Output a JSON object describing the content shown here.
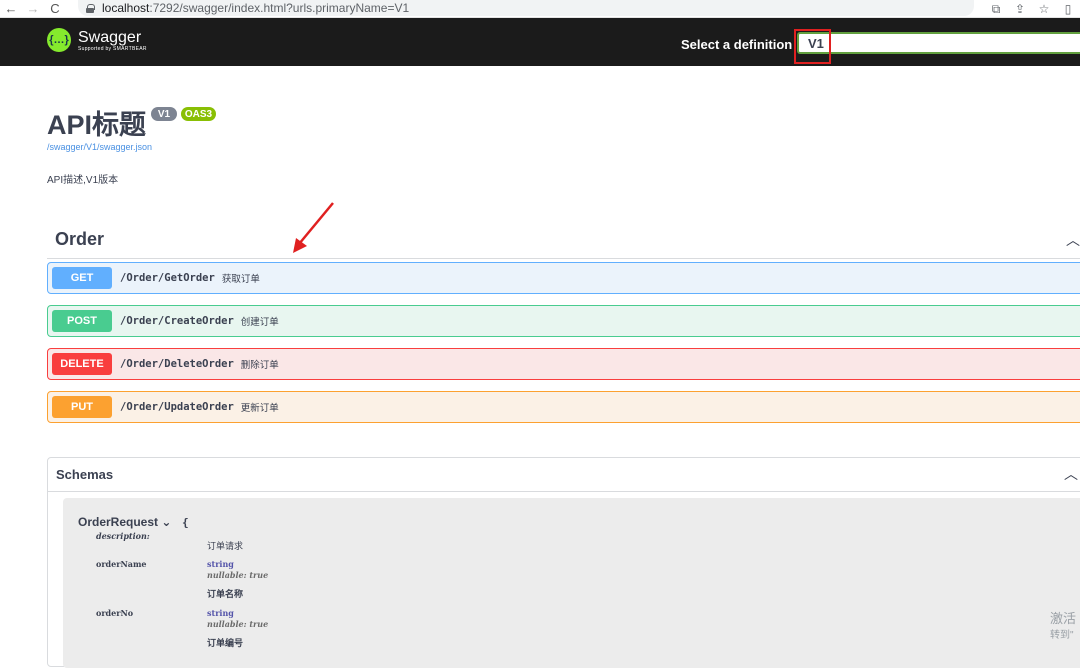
{
  "browser": {
    "url_host": "localhost",
    "url_rest": ":7292/swagger/index.html?urls.primaryName=V1",
    "back": "←",
    "forward": "→",
    "reload": "C"
  },
  "topbar": {
    "logo_mark": "{…}",
    "logo_name": "Swagger",
    "logo_sub": "Supported by SMARTBEAR",
    "select_label": "Select a definition",
    "selected_definition": "V1"
  },
  "info": {
    "title": "API标题",
    "version_badge": "V1",
    "oas_badge": "OAS3",
    "spec_url": "/swagger/V1/swagger.json",
    "description": "API描述,V1版本"
  },
  "tag": {
    "name": "Order",
    "operations": [
      {
        "method": "GET",
        "path": "/Order/GetOrder",
        "summary": "获取订单"
      },
      {
        "method": "POST",
        "path": "/Order/CreateOrder",
        "summary": "创建订单"
      },
      {
        "method": "DELETE",
        "path": "/Order/DeleteOrder",
        "summary": "删除订单"
      },
      {
        "method": "PUT",
        "path": "/Order/UpdateOrder",
        "summary": "更新订单"
      }
    ]
  },
  "schemas": {
    "title": "Schemas",
    "model": {
      "name": "OrderRequest",
      "brace": "{",
      "description_key": "description:",
      "description_value": "订单请求",
      "properties": [
        {
          "key": "orderName",
          "type": "string",
          "nullable": "nullable: true",
          "desc": "订单名称"
        },
        {
          "key": "orderNo",
          "type": "string",
          "nullable": "nullable: true",
          "desc": "订单编号"
        }
      ]
    }
  },
  "watermark": {
    "line1": "激活",
    "line2": "转到\""
  },
  "colors": {
    "get": "#61affe",
    "post": "#49cc90",
    "delete": "#f93e3e",
    "put": "#fca130",
    "topbar": "#1b1b1b",
    "logo": "#85ea2d",
    "annotation": "#e02020"
  }
}
